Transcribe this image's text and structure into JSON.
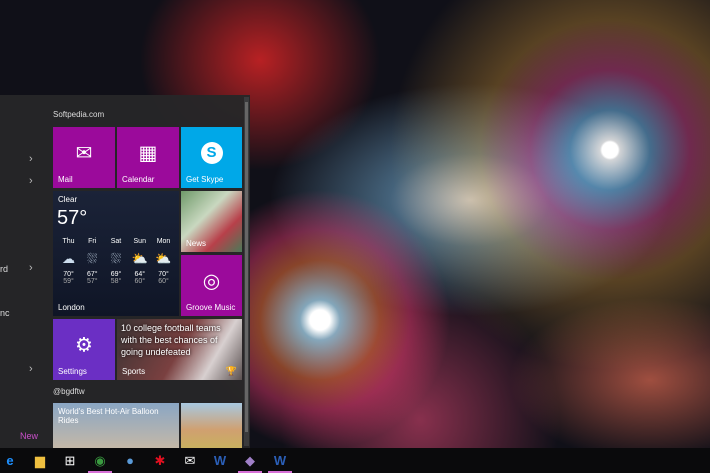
{
  "start_menu": {
    "left_fragments": [
      "rd",
      "nc"
    ],
    "new_label": "New",
    "group1": "Softpedia.com",
    "group2": "@bgdftw",
    "tiles": {
      "mail": "Mail",
      "calendar": "Calendar",
      "skype": "Get Skype",
      "news": "News",
      "groove": "Groove Music",
      "settings": "Settings",
      "sports_headline": "10 college football teams with the best chances of going undefeated",
      "sports": "Sports",
      "balloon": "World's Best Hot-Air Balloon Rides"
    },
    "weather": {
      "condition": "Clear",
      "temp": "57°",
      "location": "London",
      "days": [
        {
          "d": "Thu",
          "hi": "70°",
          "lo": "59°",
          "icon": "cloudy"
        },
        {
          "d": "Fri",
          "hi": "67°",
          "lo": "57°",
          "icon": "rain"
        },
        {
          "d": "Sat",
          "hi": "69°",
          "lo": "58°",
          "icon": "rain"
        },
        {
          "d": "Sun",
          "hi": "64°",
          "lo": "60°",
          "icon": "sun-showers"
        },
        {
          "d": "Mon",
          "hi": "70°",
          "lo": "60°",
          "icon": "sun-showers"
        }
      ]
    }
  },
  "colors": {
    "magenta": "#9b0a9b",
    "skype": "#00a8e8",
    "settings": "#6b2fc4"
  },
  "taskbar": [
    "edge",
    "file-explorer",
    "store",
    "chrome",
    "thunderbird",
    "app-red",
    "mail",
    "word",
    "app-purple",
    "word-2"
  ]
}
